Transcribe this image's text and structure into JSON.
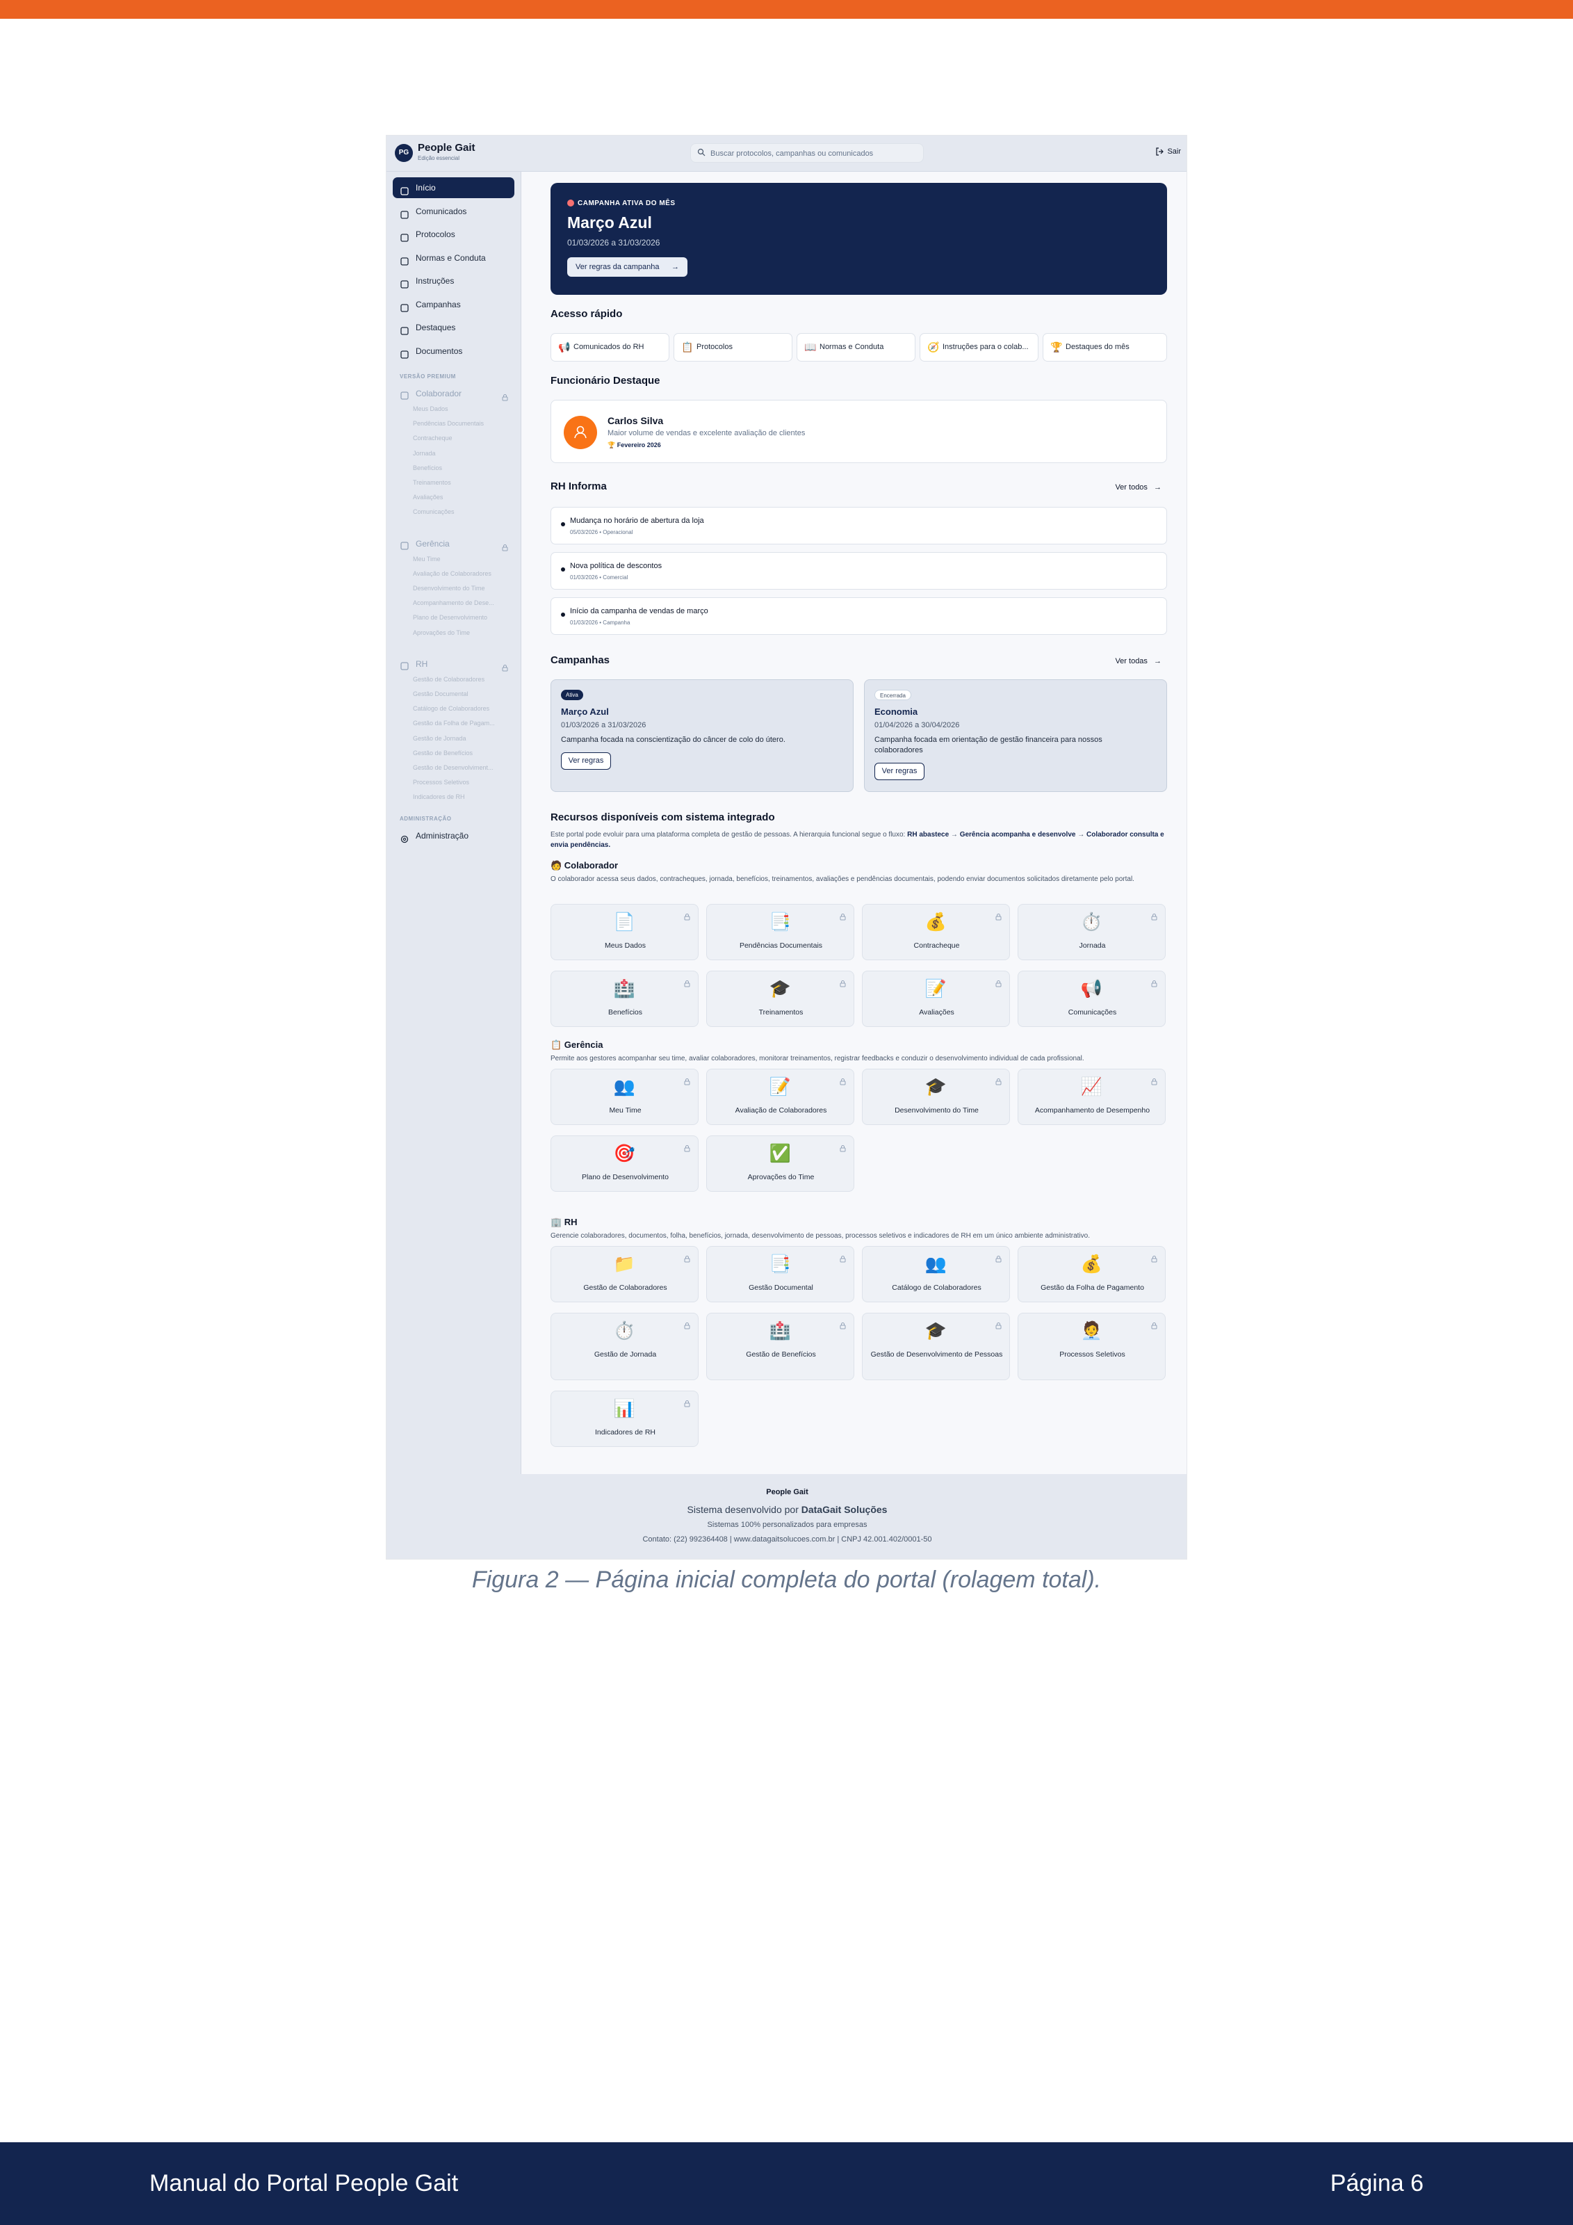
{
  "page": {
    "footer_left": "Manual do Portal People Gait",
    "footer_right": "Página 6",
    "caption": "Figura 2 — Página inicial completa do portal (rolagem total)."
  },
  "colors": {
    "accent": "#eb6221",
    "navy": "#13254f"
  },
  "header": {
    "logo": "PG",
    "brand": "People Gait",
    "brand_sub": "Edição essencial",
    "search_placeholder": "Buscar protocolos, campanhas ou comunicados",
    "logout": "Sair"
  },
  "sidebar": {
    "items": [
      {
        "label": "Início",
        "icon": "home-icon"
      },
      {
        "label": "Comunicados",
        "icon": "megaphone-icon"
      },
      {
        "label": "Protocolos",
        "icon": "clipboard-icon"
      },
      {
        "label": "Normas e Conduta",
        "icon": "book-icon"
      },
      {
        "label": "Instruções",
        "icon": "compass-icon"
      },
      {
        "label": "Campanhas",
        "icon": "trophy-icon"
      },
      {
        "label": "Destaques",
        "icon": "trophy-icon"
      },
      {
        "label": "Documentos",
        "icon": "file-icon"
      }
    ],
    "premium_label": "VERSÃO PREMIUM",
    "groups": [
      {
        "label": "Colaborador",
        "subs": [
          "Meus Dados",
          "Pendências Documentais",
          "Contracheque",
          "Jornada",
          "Benefícios",
          "Treinamentos",
          "Avaliações",
          "Comunicações"
        ]
      },
      {
        "label": "Gerência",
        "subs": [
          "Meu Time",
          "Avaliação de Colaboradores",
          "Desenvolvimento do Time",
          "Acompanhamento de Dese...",
          "Plano de Desenvolvimento",
          "Aprovações do Time"
        ]
      },
      {
        "label": "RH",
        "subs": [
          "Gestão de Colaboradores",
          "Gestão Documental",
          "Catálogo de Colaboradores",
          "Gestão da Folha de Pagam...",
          "Gestão de Jornada",
          "Gestão de Benefícios",
          "Gestão de Desenvolviment...",
          "Processos Seletivos",
          "Indicadores de RH"
        ]
      }
    ],
    "admin_label": "ADMINISTRAÇÃO",
    "admin_item": "Administração"
  },
  "hero": {
    "tag": "CAMPANHA ATIVA DO MÊS",
    "title": "Março Azul",
    "dates": "01/03/2026 a 31/03/2026",
    "button": "Ver regras da campanha"
  },
  "quick": {
    "title": "Acesso rápido",
    "items": [
      {
        "emoji": "📢",
        "label": "Comunicados do RH"
      },
      {
        "emoji": "📋",
        "label": "Protocolos"
      },
      {
        "emoji": "📖",
        "label": "Normas e Conduta"
      },
      {
        "emoji": "🧭",
        "label": "Instruções para o colab..."
      },
      {
        "emoji": "🏆",
        "label": "Destaques do mês"
      }
    ]
  },
  "featured": {
    "title": "Funcionário Destaque",
    "name": "Carlos Silva",
    "desc": "Maior volume de vendas e excelente avaliação de clientes",
    "month": "🏆 Fevereiro 2026"
  },
  "rh": {
    "title": "RH Informa",
    "more": "Ver todos",
    "items": [
      {
        "title": "Mudança no horário de abertura da loja",
        "meta": "05/03/2026 • Operacional"
      },
      {
        "title": "Nova política de descontos",
        "meta": "01/03/2026 • Comercial"
      },
      {
        "title": "Início da campanha de vendas de março",
        "meta": "01/03/2026 • Campanha"
      }
    ]
  },
  "campaigns": {
    "title": "Campanhas",
    "more": "Ver todas",
    "items": [
      {
        "badge": "Ativa",
        "title": "Março Azul",
        "dates": "01/03/2026 a 31/03/2026",
        "desc": "Campanha focada na conscientização do câncer de colo do útero.",
        "button": "Ver regras"
      },
      {
        "badge": "Encerrada",
        "title": "Economia",
        "dates": "01/04/2026 a 30/04/2026",
        "desc": "Campanha focada em orientação de gestão financeira para nossos colaboradores",
        "button": "Ver regras"
      }
    ]
  },
  "resources": {
    "title": "Recursos disponíveis com sistema integrado",
    "intro": "Este portal pode evoluir para uma plataforma completa de gestão de pessoas. A hierarquia funcional segue o fluxo:",
    "flow_a": "RH abastece",
    "flow_b": "Gerência acompanha e desenvolve",
    "flow_c": "Colaborador consulta e envia pendências.",
    "sections": [
      {
        "title": "🧑 Colaborador",
        "desc": "O colaborador acessa seus dados, contracheques, jornada, benefícios, treinamentos, avaliações e pendências documentais, podendo enviar documentos solicitados diretamente pelo portal.",
        "cards": [
          [
            "📄",
            "Meus Dados"
          ],
          [
            "📑",
            "Pendências Documentais"
          ],
          [
            "💰",
            "Contracheque"
          ],
          [
            "⏱️",
            "Jornada"
          ],
          [
            "🏥",
            "Benefícios"
          ],
          [
            "🎓",
            "Treinamentos"
          ],
          [
            "📝",
            "Avaliações"
          ],
          [
            "📢",
            "Comunicações"
          ]
        ]
      },
      {
        "title": "📋 Gerência",
        "desc": "Permite aos gestores acompanhar seu time, avaliar colaboradores, monitorar treinamentos, registrar feedbacks e conduzir o desenvolvimento individual de cada profissional.",
        "cards": [
          [
            "👥",
            "Meu Time"
          ],
          [
            "📝",
            "Avaliação de Colaboradores"
          ],
          [
            "🎓",
            "Desenvolvimento do Time"
          ],
          [
            "📈",
            "Acompanhamento de Desempenho"
          ],
          [
            "🎯",
            "Plano de Desenvolvimento"
          ],
          [
            "✅",
            "Aprovações do Time"
          ]
        ]
      },
      {
        "title": "🏢 RH",
        "desc": "Gerencie colaboradores, documentos, folha, benefícios, jornada, desenvolvimento de pessoas, processos seletivos e indicadores de RH em um único ambiente administrativo.",
        "cards": [
          [
            "📁",
            "Gestão de Colaboradores"
          ],
          [
            "📑",
            "Gestão Documental"
          ],
          [
            "👥",
            "Catálogo de Colaboradores"
          ],
          [
            "💰",
            "Gestão da Folha de Pagamento"
          ],
          [
            "⏱️",
            "Gestão de Jornada"
          ],
          [
            "🏥",
            "Gestão de Benefícios"
          ],
          [
            "🎓",
            "Gestão de Desenvolvimento de Pessoas"
          ],
          [
            "🧑‍💼",
            "Processos Seletivos"
          ],
          [
            "📊",
            "Indicadores de RH"
          ]
        ]
      }
    ]
  },
  "footer": {
    "brand": "People Gait",
    "dev_prefix": "Sistema desenvolvido por",
    "dev_name": "DataGait Soluções",
    "tagline": "Sistemas 100% personalizados para empresas",
    "contact": "Contato: (22) 992364408 | www.datagaitsolucoes.com.br | CNPJ 42.001.402/0001-50"
  }
}
